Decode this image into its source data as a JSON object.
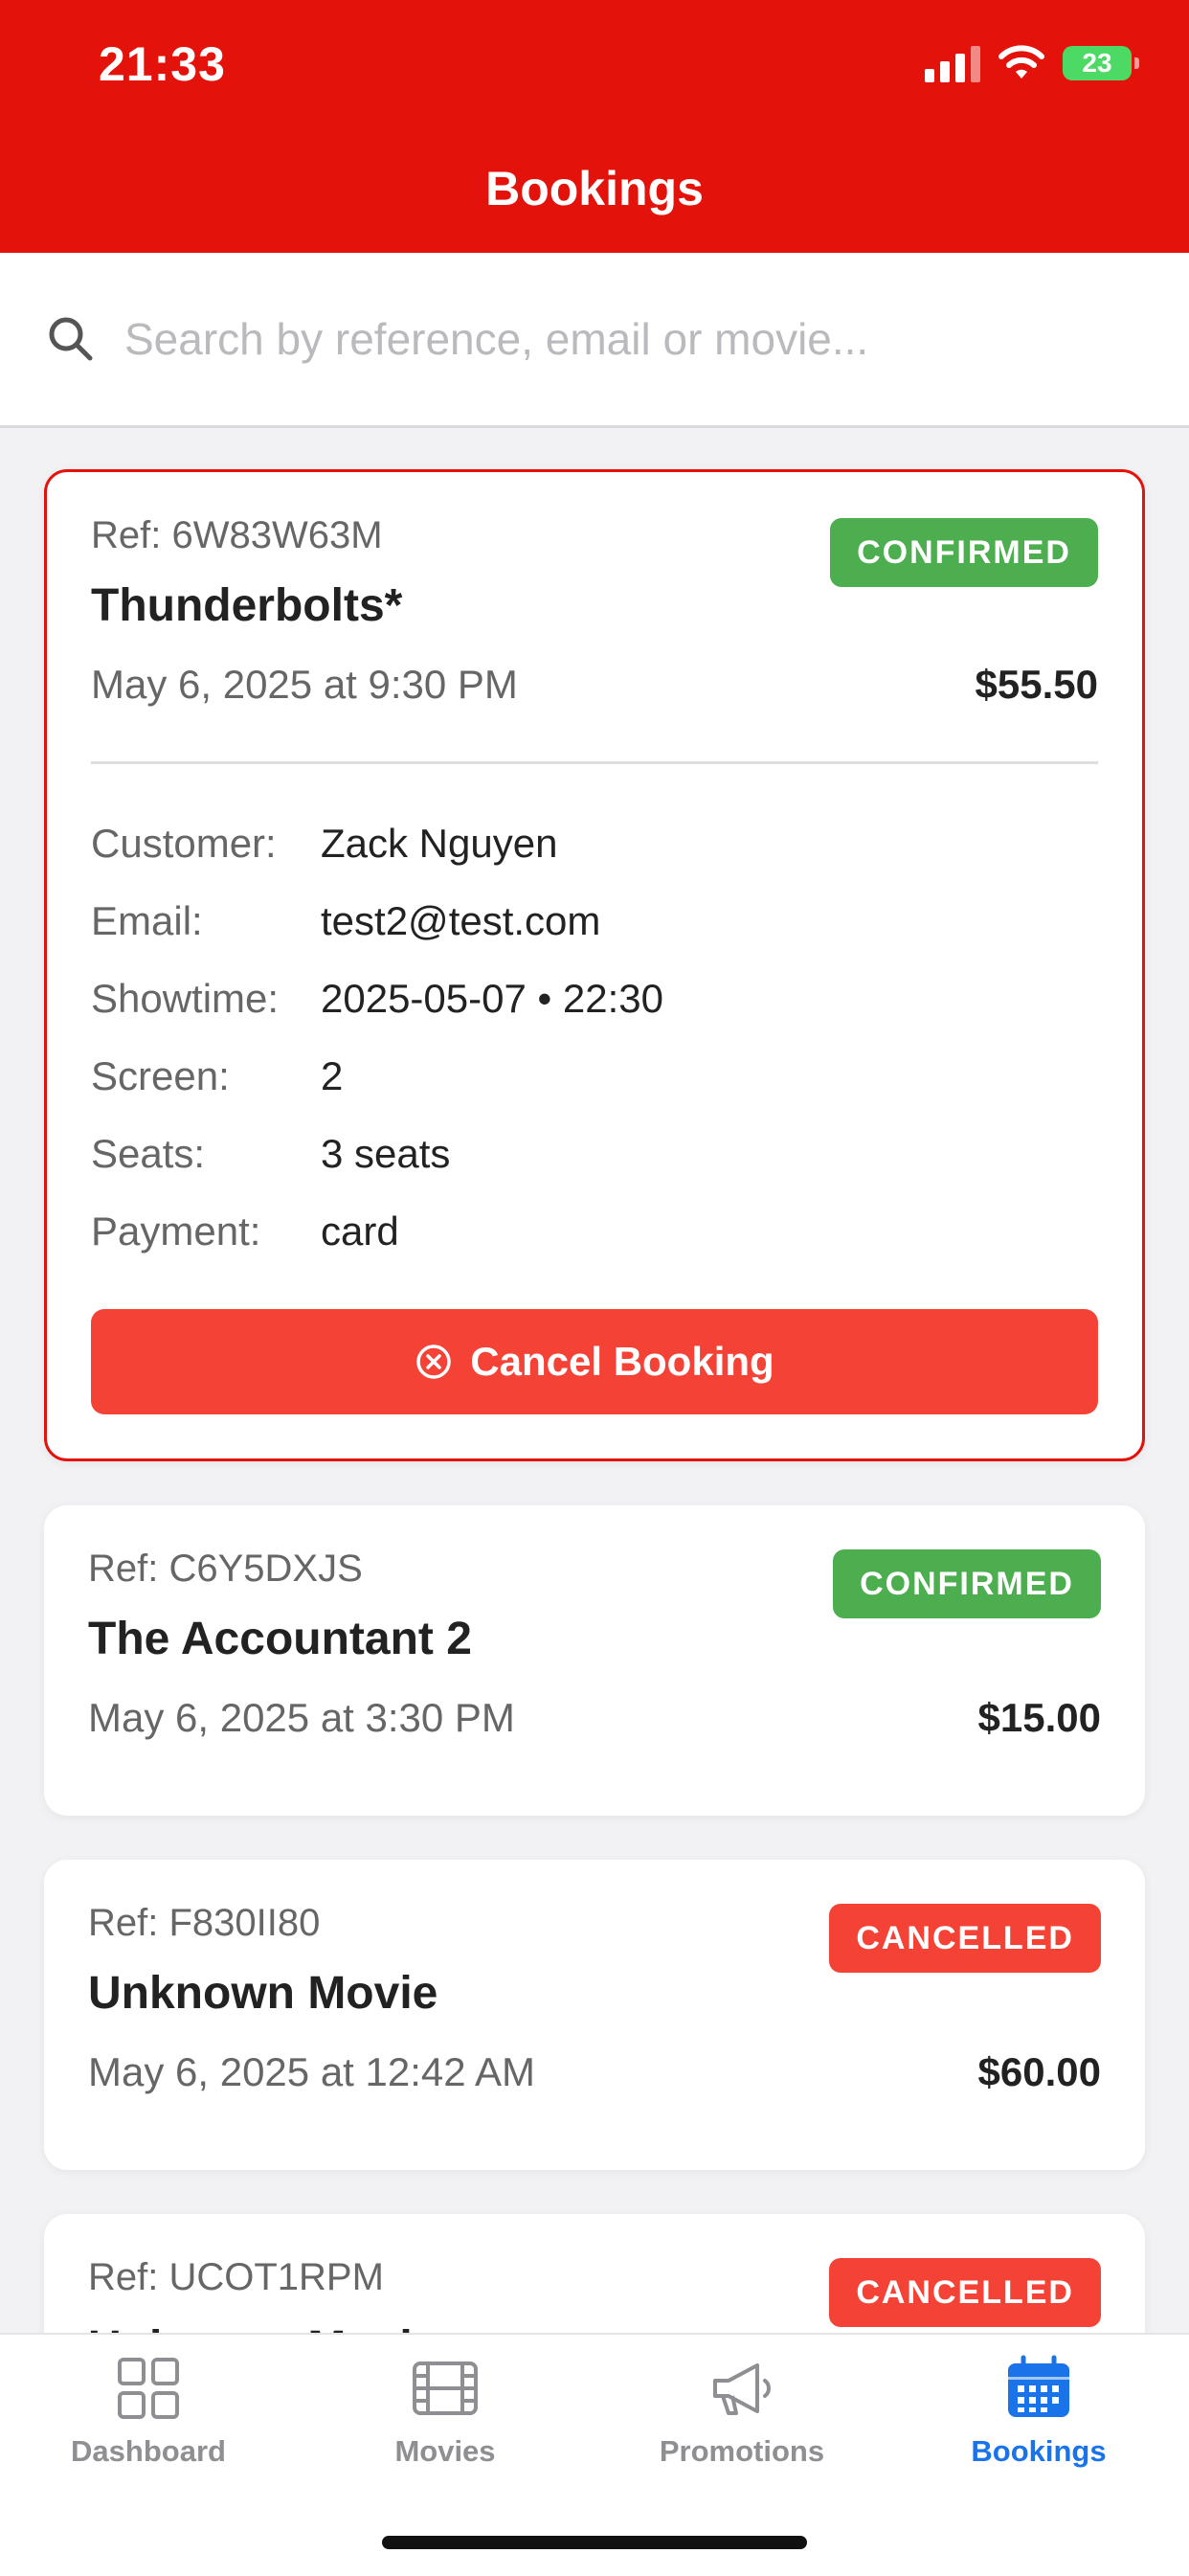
{
  "status_bar": {
    "time": "21:33",
    "battery": "23"
  },
  "header": {
    "title": "Bookings"
  },
  "search": {
    "placeholder": "Search by reference, email or movie..."
  },
  "bookings": [
    {
      "ref": "Ref: 6W83W63M",
      "title": "Thunderbolts*",
      "datetime": "May 6, 2025 at 9:30 PM",
      "price": "$55.50",
      "status": "CONFIRMED",
      "status_color": "#4cae4f",
      "details": [
        {
          "label": "Customer:",
          "value": "Zack Nguyen"
        },
        {
          "label": "Email:",
          "value": "test2@test.com"
        },
        {
          "label": "Showtime:",
          "value": "2025-05-07 • 22:30"
        },
        {
          "label": "Screen:",
          "value": "2"
        },
        {
          "label": "Seats:",
          "value": "3 seats"
        },
        {
          "label": "Payment:",
          "value": "card"
        }
      ],
      "cancel_label": "Cancel Booking"
    },
    {
      "ref": "Ref: C6Y5DXJS",
      "title": "The Accountant 2",
      "datetime": "May 6, 2025 at 3:30 PM",
      "price": "$15.00",
      "status": "CONFIRMED",
      "status_color": "#4cae4f"
    },
    {
      "ref": "Ref: F830II80",
      "title": "Unknown Movie",
      "datetime": "May 6, 2025 at 12:42 AM",
      "price": "$60.00",
      "status": "CANCELLED",
      "status_color": "#f44336"
    },
    {
      "ref": "Ref: UCOT1RPM",
      "title": "Unknown Movie",
      "status": "CANCELLED",
      "status_color": "#f44336"
    }
  ],
  "tabbar": {
    "items": [
      {
        "label": "Dashboard",
        "icon": "grid-icon"
      },
      {
        "label": "Movies",
        "icon": "film-icon"
      },
      {
        "label": "Promotions",
        "icon": "megaphone-icon"
      },
      {
        "label": "Bookings",
        "icon": "calendar-icon",
        "active": true
      }
    ]
  },
  "colors": {
    "brand": "#e3120b",
    "confirmed": "#4cae4f",
    "cancelled": "#f44336",
    "active_tab": "#1a73e8"
  }
}
